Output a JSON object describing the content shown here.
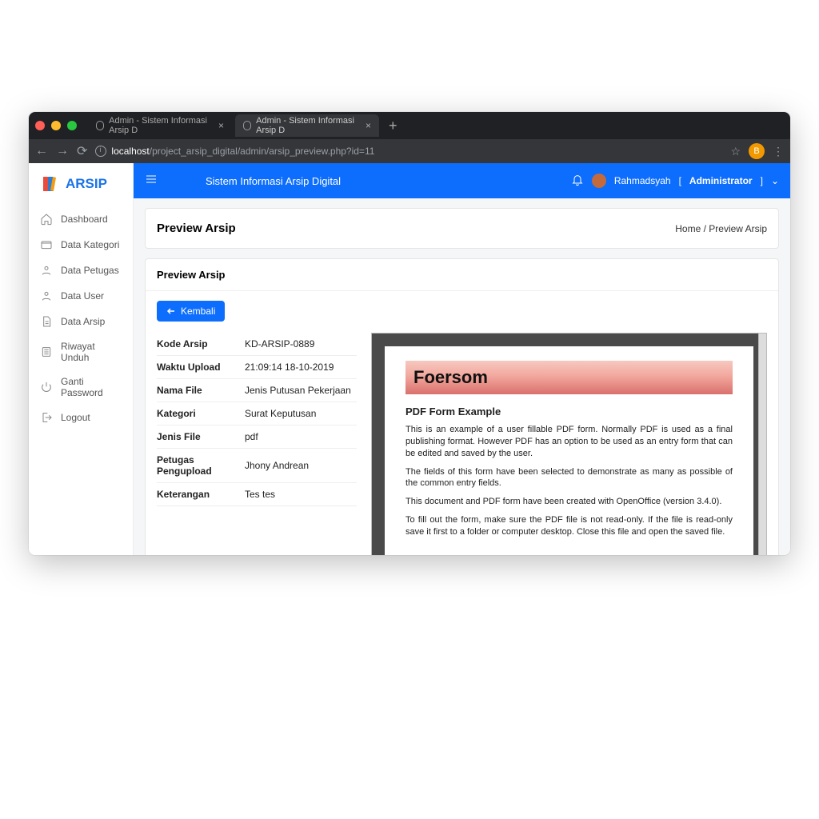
{
  "browser": {
    "tabs": [
      {
        "title": "Admin - Sistem Informasi Arsip D",
        "active": false
      },
      {
        "title": "Admin - Sistem Informasi Arsip D",
        "active": true
      }
    ],
    "address_host": "localhost",
    "address_path": "/project_arsip_digital/admin/arsip_preview.php?id=11",
    "profile_badge": "B"
  },
  "brand": "ARSIP",
  "app_title": "Sistem Informasi Arsip Digital",
  "user": {
    "name": "Rahmadsyah",
    "role_open": "[",
    "role": "Administrator",
    "role_close": "]"
  },
  "sidebar": {
    "items": [
      {
        "label": "Dashboard"
      },
      {
        "label": "Data Kategori"
      },
      {
        "label": "Data Petugas"
      },
      {
        "label": "Data User"
      },
      {
        "label": "Data Arsip"
      },
      {
        "label": "Riwayat Unduh"
      },
      {
        "label": "Ganti Password"
      },
      {
        "label": "Logout"
      }
    ]
  },
  "page": {
    "title": "Preview Arsip",
    "breadcrumb": {
      "home": "Home",
      "sep": " / ",
      "current": "Preview Arsip"
    },
    "card_title": "Preview Arsip",
    "back_label": "Kembali"
  },
  "arsip": {
    "keys": {
      "kode": "Kode Arsip",
      "waktu": "Waktu Upload",
      "nama": "Nama File",
      "kategori": "Kategori",
      "jenis": "Jenis File",
      "petugas": "Petugas Pengupload",
      "ket": "Keterangan"
    },
    "kode": "KD-ARSIP-0889",
    "waktu": "21:09:14 18-10-2019",
    "nama": "Jenis Putusan Pekerjaan",
    "kategori": "Surat Keputusan",
    "jenis": "pdf",
    "petugas": "Jhony Andrean",
    "ket": "Tes tes"
  },
  "pdf": {
    "banner": "Foersom",
    "title": "PDF Form Example",
    "p1": "This is an example of a user fillable PDF form. Normally PDF is used as a final publishing format. However PDF has an option to be used as an entry form that can be edited and saved by the user.",
    "p2": "The fields of this form have been selected to demonstrate as many as possible of the common entry fields.",
    "p3": "This document and PDF form have been created with OpenOffice (version 3.4.0).",
    "p4": "To fill out the form, make sure the PDF file is not read-only. If the file is read-only save it first to a folder or computer desktop. Close this file and open the saved file."
  }
}
